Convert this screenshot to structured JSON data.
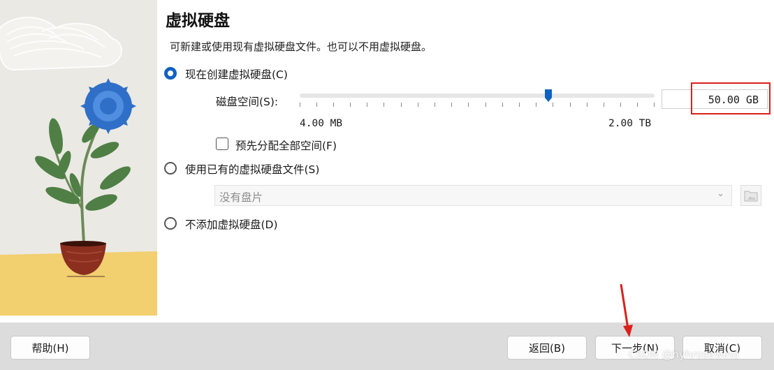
{
  "dialog": {
    "title": "虚拟硬盘",
    "subtitle": "可新建或使用现有虚拟硬盘文件。也可以不用虚拟硬盘。"
  },
  "options": {
    "create_new": {
      "label": "现在创建虚拟硬盘(C)",
      "selected": true
    },
    "disk_size": {
      "label": "磁盘空间(S):",
      "value": "50.00 GB",
      "min_label": "4.00 MB",
      "max_label": "2.00 TB",
      "slider_fraction": 0.7
    },
    "preallocate": {
      "label": "预先分配全部空间(F)",
      "checked": false
    },
    "use_existing": {
      "label": "使用已有的虚拟硬盘文件(S)",
      "selected": false
    },
    "existing_combo": {
      "value": "没有盘片"
    },
    "no_disk": {
      "label": "不添加虚拟硬盘(D)",
      "selected": false
    }
  },
  "buttons": {
    "help": "帮助(H)",
    "back": "返回(B)",
    "next": "下一步(N)",
    "cancel": "取消(C)"
  },
  "watermark": "CSDN @hyhrosewind",
  "colors": {
    "accent": "#0f62c2",
    "highlight": "#d9201c",
    "footer": "#dcdcdc",
    "sidebar": "#ebe9e4"
  },
  "icons": [
    "radio-selected-icon",
    "radio-icon",
    "checkbox-icon",
    "chevron-down-icon",
    "folder-icon",
    "red-arrow-annotation"
  ]
}
